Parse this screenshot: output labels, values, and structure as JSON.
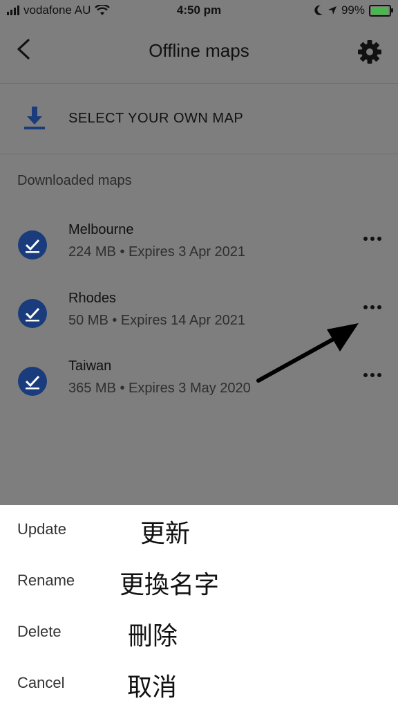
{
  "status_bar": {
    "carrier": "vodafone AU",
    "time": "4:50 pm",
    "battery": "99%"
  },
  "header": {
    "title": "Offline maps"
  },
  "select_map": {
    "label": "SELECT YOUR OWN MAP"
  },
  "downloaded": {
    "section_label": "Downloaded maps",
    "items": [
      {
        "name": "Melbourne",
        "details": "224 MB • Expires 3 Apr 2021"
      },
      {
        "name": "Rhodes",
        "details": "50 MB • Expires 14 Apr 2021"
      },
      {
        "name": "Taiwan",
        "details": "365 MB • Expires 3 May 2020"
      }
    ]
  },
  "sheet": {
    "options": [
      {
        "label": "Update",
        "zh": "更新"
      },
      {
        "label": "Rename",
        "zh": "更換名字"
      },
      {
        "label": "Delete",
        "zh": "刪除"
      },
      {
        "label": "Cancel",
        "zh": "取消"
      }
    ]
  },
  "colors": {
    "overlay": "#7e7e7e",
    "check": "#1a3c7c",
    "download": "#1a3c7c",
    "battery_fill": "#49b84a"
  }
}
